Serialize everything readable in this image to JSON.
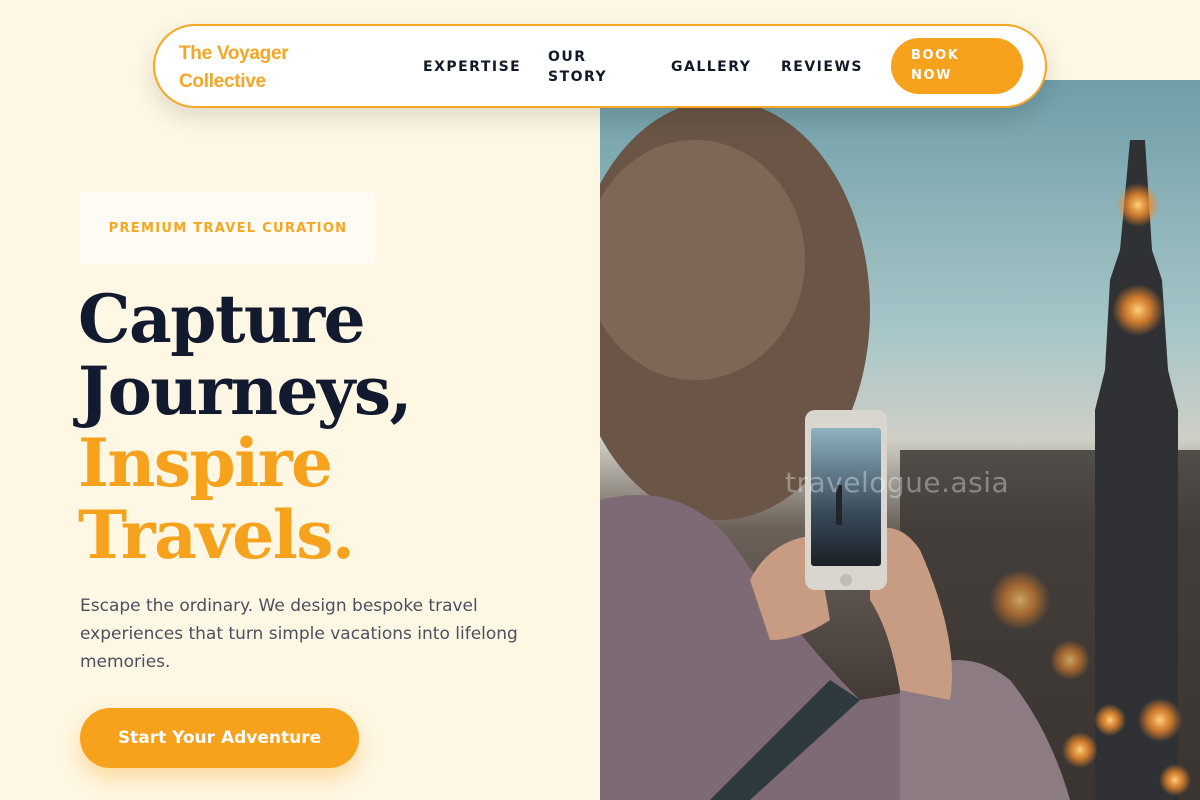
{
  "brand": {
    "name": "The Voyager Collective"
  },
  "nav": {
    "links": [
      "EXPERTISE",
      "OUR STORY",
      "GALLERY",
      "REVIEWS"
    ],
    "cta_label": "BOOK NOW"
  },
  "hero": {
    "badge": "PREMIUM TRAVEL CURATION",
    "headline_line1": "Capture",
    "headline_line2": "Journeys,",
    "headline_line3": "Inspire",
    "headline_line4": "Travels.",
    "subtext": "Escape the ordinary. We design bespoke travel experiences that turn simple vacations into lifelong memories.",
    "cta_label": "Start Your Adventure",
    "image_watermark": "travelogue.asia"
  },
  "colors": {
    "accent": "#f7a21d",
    "background": "#fef7e3",
    "heading": "#121a30",
    "body_text": "#4b5060"
  }
}
